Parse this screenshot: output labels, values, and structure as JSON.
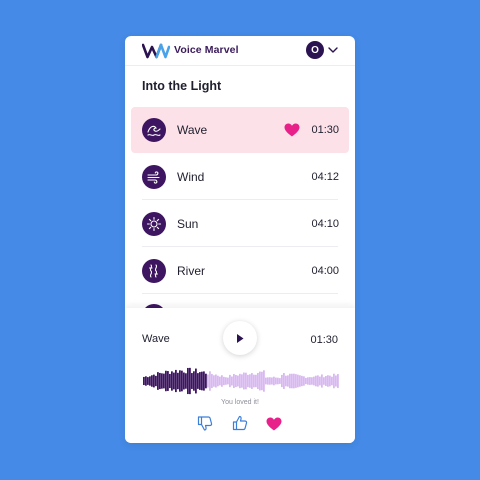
{
  "app": {
    "brand": "Voice Marvel",
    "avatar_initial": "O"
  },
  "playlist": {
    "title": "Into the Light"
  },
  "tracks": [
    {
      "name": "Wave",
      "duration": "01:30",
      "icon": "wave-icon",
      "active": true,
      "loved": true
    },
    {
      "name": "Wind",
      "duration": "04:12",
      "icon": "wind-icon",
      "active": false,
      "loved": false
    },
    {
      "name": "Sun",
      "duration": "04:10",
      "icon": "sun-icon",
      "active": false,
      "loved": false
    },
    {
      "name": "River",
      "duration": "04:00",
      "icon": "river-icon",
      "active": false,
      "loved": false
    }
  ],
  "player": {
    "title": "Wave",
    "duration": "01:30",
    "progress": 0.32,
    "feedback": "You loved it!"
  },
  "colors": {
    "background": "#448ae6",
    "brand_purple": "#3d1560",
    "active_row": "#fce1e8",
    "heart_pink": "#e8218a",
    "wave_played": "#3d1560",
    "wave_unplayed": "#d8b8ee",
    "feedback_blue": "#3b7fd9"
  }
}
